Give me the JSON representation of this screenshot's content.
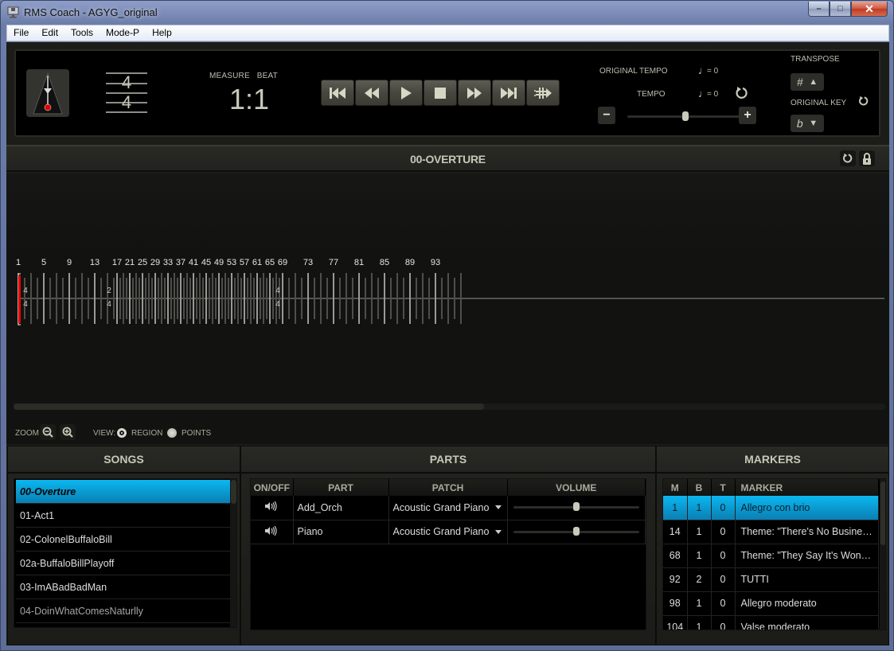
{
  "window": {
    "title": "RMS Coach - AGYG_original",
    "controls": {
      "minimize": "–",
      "maximize": "□",
      "close": "✕"
    }
  },
  "menu": [
    {
      "label": "File"
    },
    {
      "label": "Edit"
    },
    {
      "label": "Tools"
    },
    {
      "label": "Mode-P"
    },
    {
      "label": "Help"
    }
  ],
  "transport": {
    "metronome_icon": "metronome-icon",
    "time_signature": {
      "numerator": "4",
      "denominator": "4"
    },
    "measure_beat_label": "MEASURE   BEAT",
    "measure_beat_value": "1:1",
    "buttons": [
      {
        "name": "go-to-start",
        "icon": "skip-back-icon"
      },
      {
        "name": "rewind",
        "icon": "rewind-icon"
      },
      {
        "name": "play",
        "icon": "play-icon"
      },
      {
        "name": "stop",
        "icon": "stop-icon"
      },
      {
        "name": "fast-forward",
        "icon": "fast-forward-icon"
      },
      {
        "name": "go-to-end",
        "icon": "skip-forward-icon"
      },
      {
        "name": "loop",
        "icon": "repeat-arrow-icon"
      }
    ],
    "original_tempo_label": "ORIGINAL TEMPO",
    "original_tempo_value": "= 0",
    "tempo_label": "TEMPO",
    "tempo_value": "= 0",
    "tempo_slider_fraction": 0.5,
    "minus_label": "−",
    "plus_label": "+",
    "transpose_label": "TRANSPOSE",
    "transpose_sharp": "#",
    "original_key_label": "ORIGINAL KEY",
    "original_key_flat": "b"
  },
  "song_bar": {
    "title": "00-OVERTURE"
  },
  "timeline": {
    "measure_labels": [
      "1",
      "5",
      "9",
      "13",
      "17",
      "21",
      "25",
      "29",
      "33",
      "37",
      "41",
      "45",
      "49",
      "53",
      "57",
      "61",
      "65",
      "69",
      "73",
      "77",
      "81",
      "85",
      "89",
      "93"
    ],
    "time_signature_changes": [
      {
        "measure": 1,
        "numerator": "4",
        "denominator": "4"
      },
      {
        "measure": 16,
        "numerator": "2",
        "denominator": "4"
      },
      {
        "measure": 69,
        "numerator": "4",
        "denominator": "4"
      }
    ],
    "playhead_measure": 1,
    "scroll_fraction": 0.54
  },
  "zoom_bar": {
    "zoom_label": "ZOOM",
    "view_label": "VIEW:",
    "region_label": "REGION",
    "points_label": "POINTS",
    "selected_view": "REGION"
  },
  "songs": {
    "header": "SONGS",
    "items": [
      {
        "label": "00-Overture",
        "selected": true
      },
      {
        "label": "01-Act1"
      },
      {
        "label": "02-ColonelBuffaloBill"
      },
      {
        "label": "02a-BuffaloBillPlayoff"
      },
      {
        "label": "03-ImABadBadMan"
      },
      {
        "label": "04-DoinWhatComesNaturlly"
      }
    ]
  },
  "parts": {
    "header": "PARTS",
    "columns": [
      "ON/OFF",
      "PART",
      "PATCH",
      "VOLUME"
    ],
    "rows": [
      {
        "part": "Add_Orch",
        "patch": "Acoustic Grand Piano",
        "volume": 0.5
      },
      {
        "part": "Piano",
        "patch": "Acoustic Grand Piano",
        "volume": 0.5
      }
    ]
  },
  "markers": {
    "header": "MARKERS",
    "columns": [
      "M",
      "B",
      "T",
      "MARKER"
    ],
    "rows": [
      {
        "m": "1",
        "b": "1",
        "t": "0",
        "marker": "Allegro con brio",
        "selected": true
      },
      {
        "m": "14",
        "b": "1",
        "t": "0",
        "marker": "Theme: \"There's No Busines..."
      },
      {
        "m": "68",
        "b": "1",
        "t": "0",
        "marker": "Theme: \"They Say It's Wond..."
      },
      {
        "m": "92",
        "b": "2",
        "t": "0",
        "marker": "TUTTI"
      },
      {
        "m": "98",
        "b": "1",
        "t": "0",
        "marker": "Allegro moderato"
      },
      {
        "m": "104",
        "b": "1",
        "t": "0",
        "marker": "Valse moderato"
      }
    ]
  }
}
